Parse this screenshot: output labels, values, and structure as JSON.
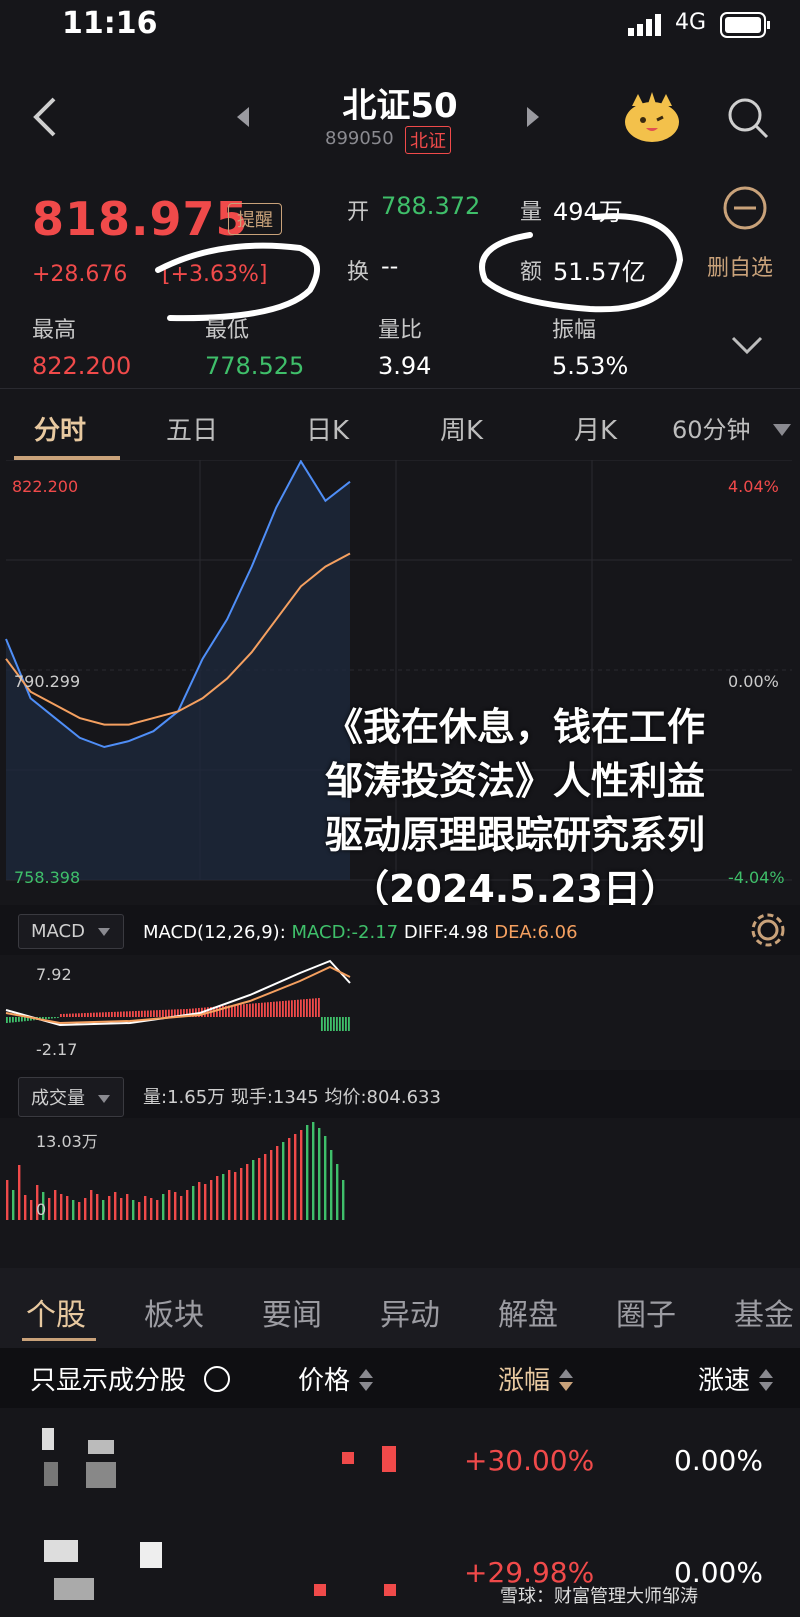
{
  "status_bar": {
    "time": "11:16",
    "network": "4G"
  },
  "nav": {
    "title": "北证50",
    "code": "899050",
    "market": "北证"
  },
  "quote": {
    "price": "818.975",
    "remind_label": "提醒",
    "change": "+28.676",
    "change_pct": "[+3.63%]",
    "open_label": "开",
    "open": "788.372",
    "volume_label": "量",
    "volume": "494万",
    "turnover_label": "换",
    "turnover": "--",
    "amount_label": "额",
    "amount": "51.57亿",
    "remove_label": "删自选",
    "high_label": "最高",
    "high": "822.200",
    "low_label": "最低",
    "low": "778.525",
    "vol_ratio_label": "量比",
    "vol_ratio": "3.94",
    "amplitude_label": "振幅",
    "amplitude": "5.53%"
  },
  "tabs": [
    "分时",
    "五日",
    "日K",
    "周K",
    "月K",
    "60分钟"
  ],
  "chart_data": {
    "type": "line",
    "series": [
      {
        "name": "",
        "values": [
          795,
          786,
          783,
          780,
          778.6,
          779.5,
          781,
          784,
          792,
          798,
          806,
          815,
          822,
          816,
          818.9
        ]
      },
      {
        "name": "",
        "values": [
          792,
          787,
          785,
          783,
          782,
          782,
          783,
          784,
          786,
          789,
          793,
          798,
          803,
          806,
          808
        ]
      }
    ],
    "ylim": [
      758.398,
      822.2
    ],
    "y_left_labels": [
      "822.200",
      "790.299",
      "758.398"
    ],
    "y_right_labels": [
      "4.04%",
      "0.00%",
      "-4.04%"
    ]
  },
  "overlay_text": [
    "《我在休息，钱在工作",
    "邹涛投资法》人性利益",
    "驱动原理跟踪研究系列",
    "（2024.5.23日）"
  ],
  "macd": {
    "selector": "MACD",
    "params": "MACD(12,26,9):",
    "macd": "MACD:-2.17",
    "diff": "DIFF:4.98",
    "dea": "DEA:6.06",
    "top_label": "7.92",
    "bottom_label": "-2.17"
  },
  "volume": {
    "selector": "成交量",
    "info": "量:1.65万  现手:1345  均价:804.633",
    "top_label": "13.03万",
    "bottom_label": "0"
  },
  "lower_tabs": [
    "个股",
    "板块",
    "要闻",
    "异动",
    "解盘",
    "圈子",
    "基金"
  ],
  "table_header": {
    "filter": "只显示成分股",
    "price": "价格",
    "change": "涨幅",
    "speed": "涨速"
  },
  "rows": [
    {
      "change": "+30.00%",
      "speed": "0.00%"
    },
    {
      "change": "+29.98%",
      "speed": "0.00%"
    }
  ],
  "footer": "雪球：财富管理大师邹涛",
  "colors": {
    "up": "#f04a4a",
    "down": "#3fbf6a",
    "accent": "#c9a27a",
    "price_line": "#4f8ef7",
    "avg_line": "#f5a060"
  }
}
